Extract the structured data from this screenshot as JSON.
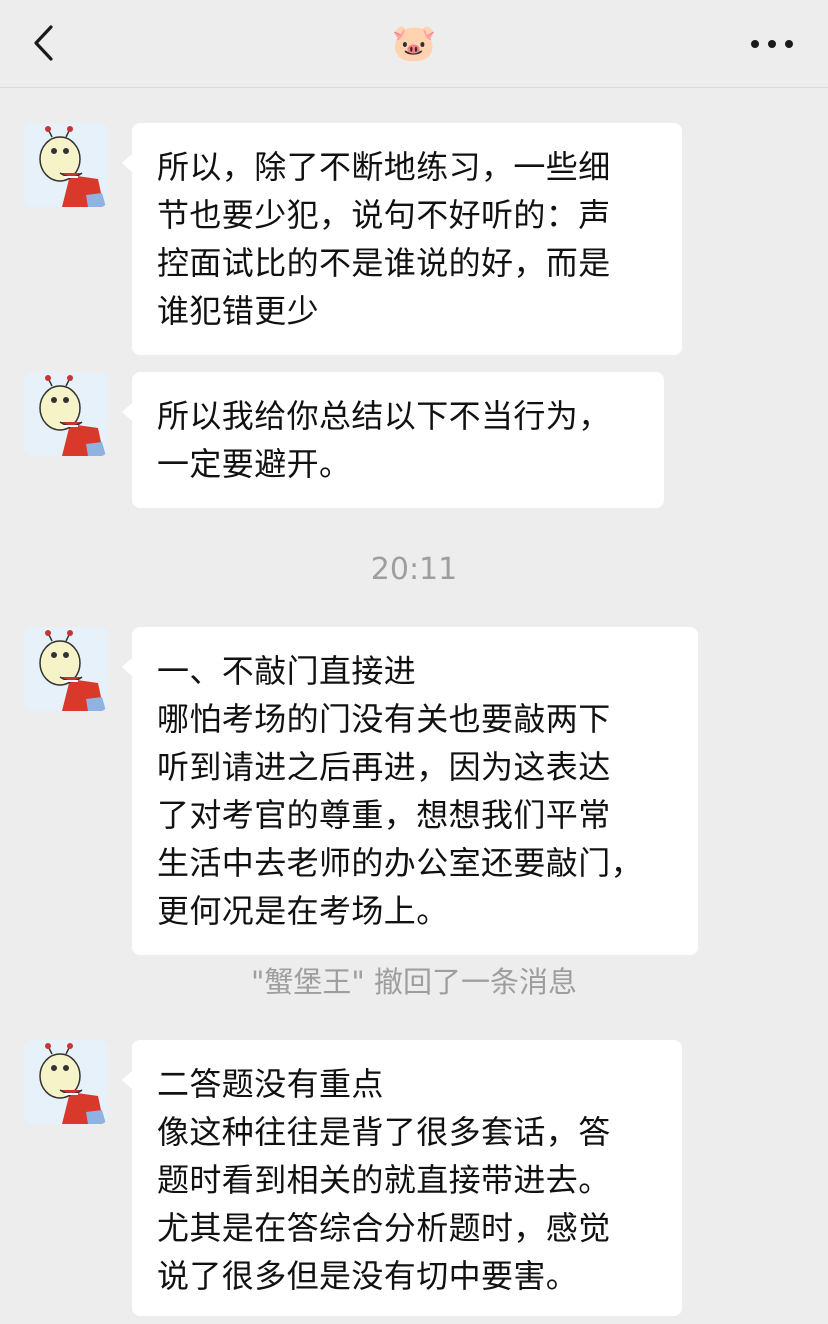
{
  "header": {
    "title": "🐷"
  },
  "messages": [
    {
      "text": "所以，除了不断地练习，一些细\n节也要少犯，说句不好听的：声\n控面试比的不是谁说的好，而是\n谁犯错更少"
    },
    {
      "text": "所以我给你总结以下不当行为，\n一定要避开。"
    },
    {
      "text": "一、不敲门直接进\n哪怕考场的门没有关也要敲两下\n听到请进之后再进，因为这表达\n了对考官的尊重，想想我们平常\n生活中去老师的办公室还要敲门，\n更何况是在考场上。"
    },
    {
      "text": "二答题没有重点\n像这种往往是背了很多套话，答\n题时看到相关的就直接带进去。\n尤其是在答综合分析题时，感觉\n说了很多但是没有切中要害。"
    }
  ],
  "timestamp": "20:11",
  "recall_notice": "\"蟹堡王\" 撤回了一条消息",
  "icons": {
    "back": "chevron-left-icon",
    "more": "more-dots-icon",
    "avatar": "crab-cartoon-avatar"
  }
}
